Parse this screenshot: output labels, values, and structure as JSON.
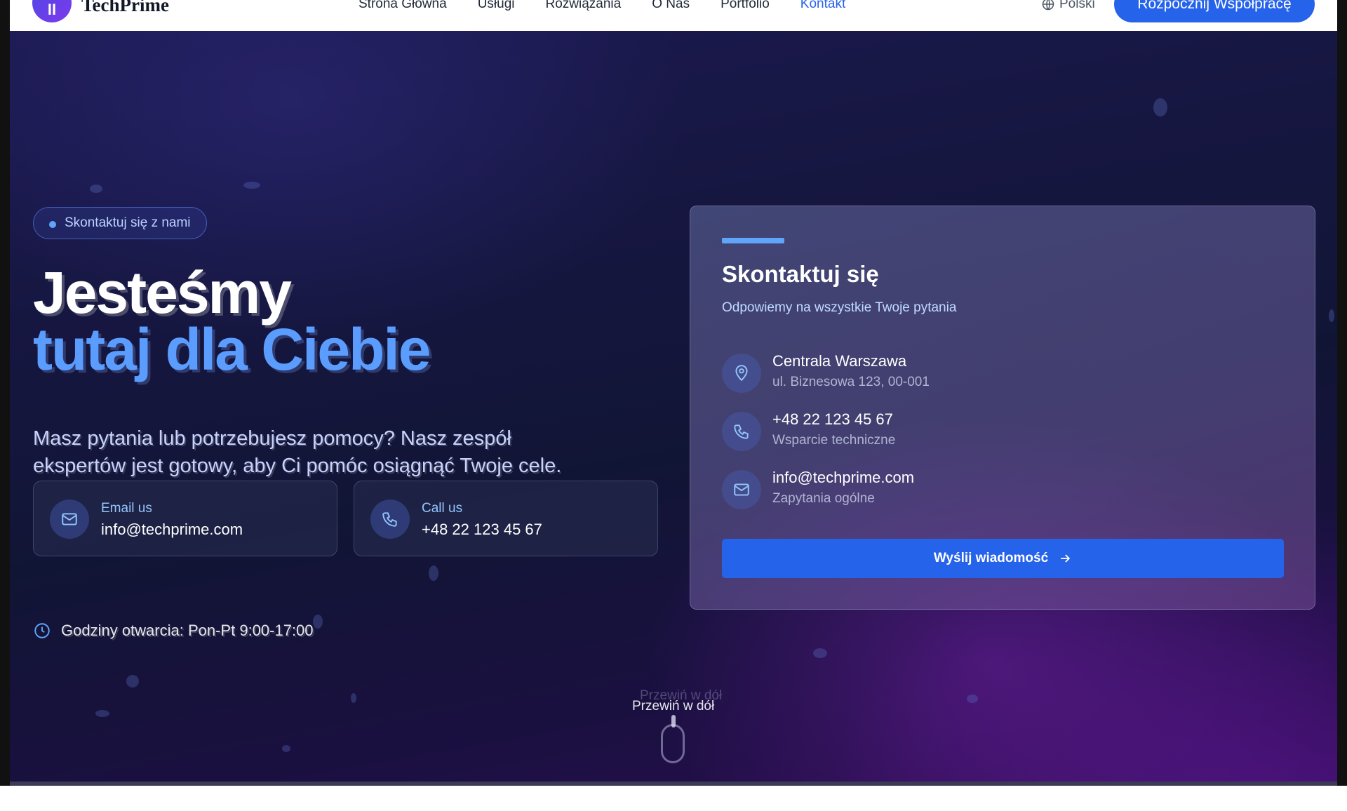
{
  "brand": {
    "logo_letter": "II",
    "name": "TechPrime"
  },
  "nav": {
    "links": [
      {
        "label": "Strona Główna",
        "active": false
      },
      {
        "label": "Usługi",
        "active": false
      },
      {
        "label": "Rozwiązania",
        "active": false
      },
      {
        "label": "O Nas",
        "active": false
      },
      {
        "label": "Portfolio",
        "active": false
      },
      {
        "label": "Kontakt",
        "active": true
      }
    ],
    "language": "Polski",
    "cta": "Rozpocznij Współpracę"
  },
  "hero": {
    "badge": "Skontaktuj się z nami",
    "title_line1": "Jesteśmy",
    "title_line2": "tutaj dla Ciebie",
    "lead": "Masz pytania lub potrzebujesz pomocy? Nasz zespół ekspertów jest gotowy, aby Ci pomóc osiągnąć Twoje cele.",
    "cards": [
      {
        "icon": "mail-icon",
        "label": "Email us",
        "value": "info@techprime.com"
      },
      {
        "icon": "phone-icon",
        "label": "Call us",
        "value": "+48 22 123 45 67"
      }
    ],
    "hours": "Godziny otwarcia: Pon-Pt 9:00-17:00",
    "scroll_label": "Przewiń w dół"
  },
  "contact_panel": {
    "title": "Skontaktuj się",
    "subtitle": "Odpowiemy na wszystkie Twoje pytania",
    "items": [
      {
        "icon": "map-pin-icon",
        "main": "Centrala Warszawa",
        "sub": "ul. Biznesowa 123, 00-001"
      },
      {
        "icon": "phone-icon",
        "main": "+48 22 123 45 67",
        "sub": "Wsparcie techniczne"
      },
      {
        "icon": "mail-icon",
        "main": "info@techprime.com",
        "sub": "Zapytania ogólne"
      }
    ],
    "button": "Wyślij wiadomość"
  },
  "colors": {
    "accent": "#2563eb",
    "accent_light": "#5b9cff",
    "hero_bg": "#151539",
    "hero_bg_purple": "#2a0d50"
  }
}
